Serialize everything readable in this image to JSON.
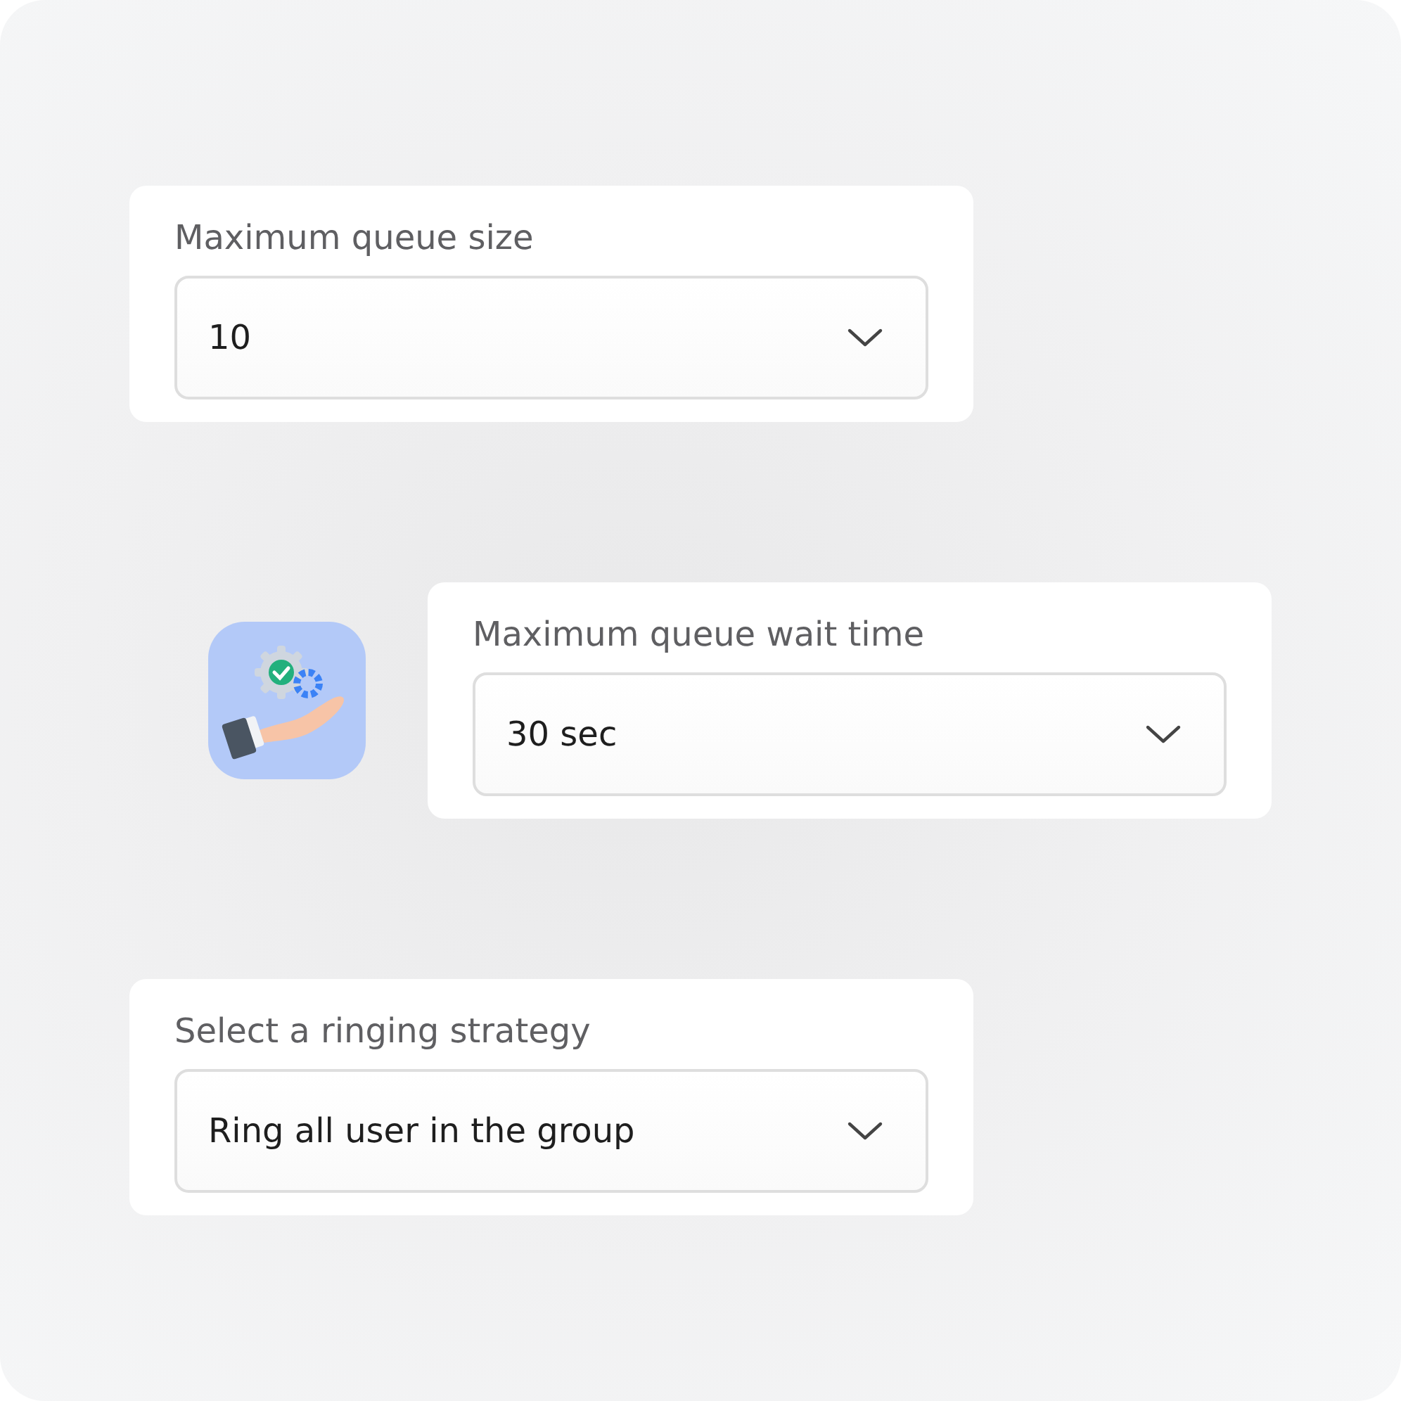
{
  "selects": [
    {
      "label": "Maximum queue size",
      "value": "10"
    },
    {
      "label": "Maximum queue wait time",
      "value": "30 sec"
    },
    {
      "label": "Select a ringing strategy",
      "value": "Ring all user in the group"
    }
  ]
}
